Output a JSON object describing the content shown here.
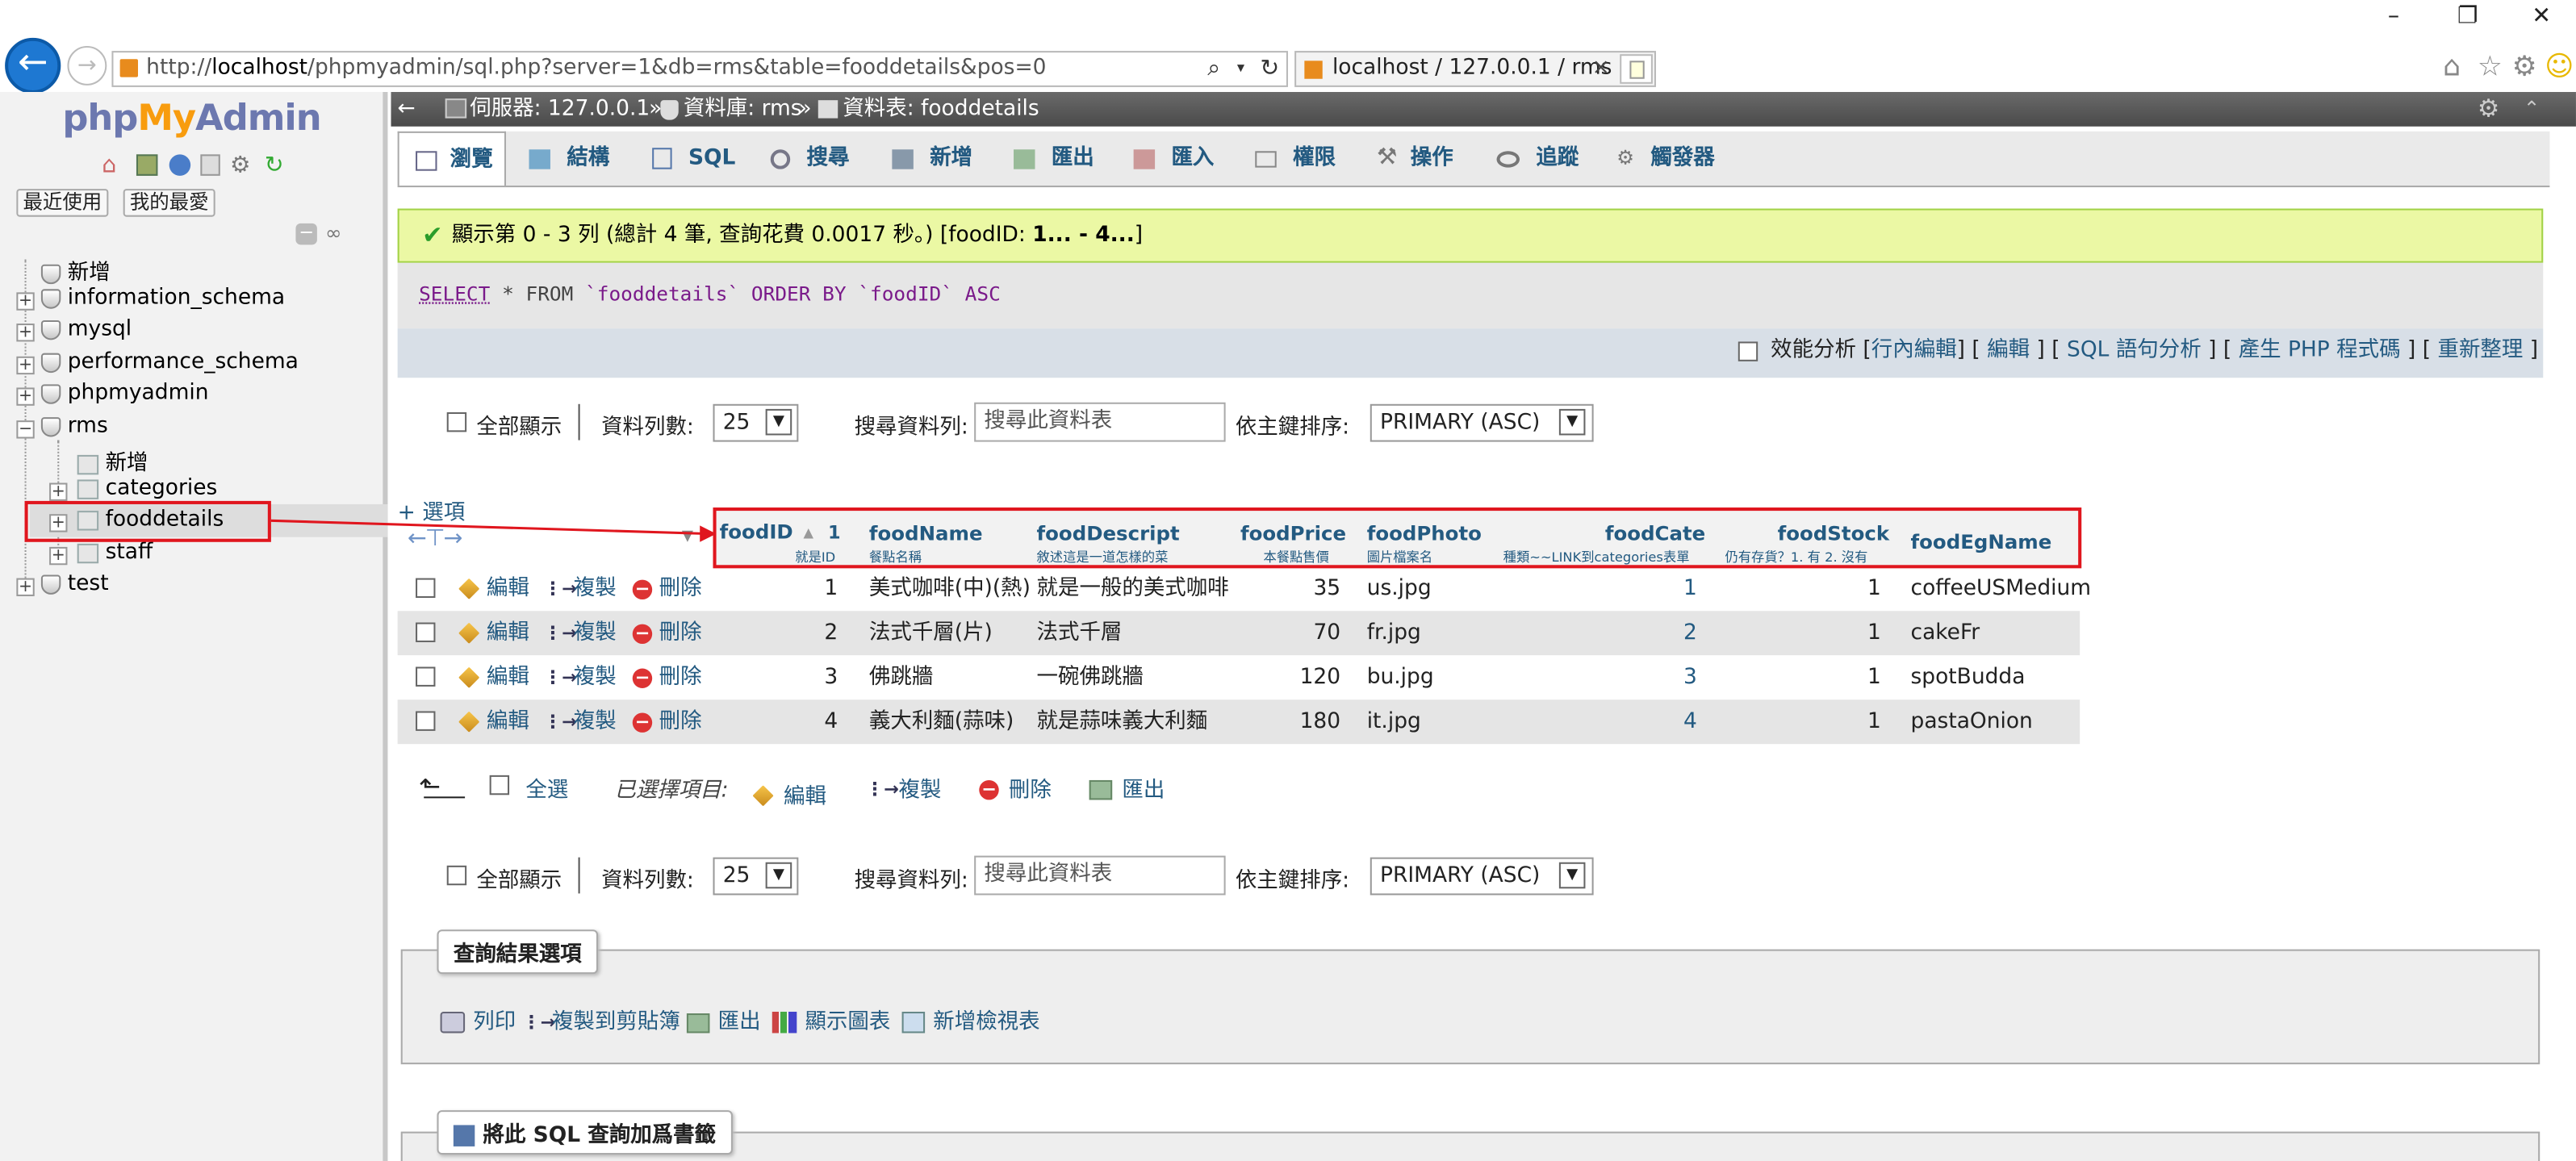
{
  "browser": {
    "url_prefix": "http://",
    "url_host": "localhost",
    "url_path": "/phpmyadmin/sql.php?server=1&db=rms&table=fooddetails&pos=0",
    "tab_title": "localhost / 127.0.0.1 / rms ...",
    "tab_close": "×",
    "win_min": "–",
    "win_restore": "❐",
    "win_close": "✕"
  },
  "sidebar": {
    "logo_php": "php",
    "logo_my": "My",
    "logo_admin": "Admin",
    "recent_label": "最近使用",
    "favorites_label": "我的最愛",
    "tree": [
      {
        "label": "新增"
      },
      {
        "label": "information_schema"
      },
      {
        "label": "mysql"
      },
      {
        "label": "performance_schema"
      },
      {
        "label": "phpmyadmin"
      },
      {
        "label": "rms"
      },
      {
        "label": "新增"
      },
      {
        "label": "categories"
      },
      {
        "label": "fooddetails"
      },
      {
        "label": "staff"
      },
      {
        "label": "test"
      }
    ]
  },
  "breadcrumb": {
    "server": "伺服器: 127.0.0.1",
    "sep1": "»",
    "database": "資料庫: rms",
    "sep2": "»",
    "table": "資料表: fooddetails"
  },
  "tabs": [
    "瀏覽",
    "結構",
    "SQL",
    "搜尋",
    "新增",
    "匯出",
    "匯入",
    "權限",
    "操作",
    "追蹤",
    "觸發器"
  ],
  "message": {
    "prefix": "顯示第 0 - 3 列 (總計 4 筆, 查詢花費 0.0017 秒。) [foodID: ",
    "bold": "1... - 4...",
    "suffix": "]"
  },
  "sql": {
    "keyword1": "SELECT",
    "rest1": " * FROM ",
    "table": "`fooddetails`",
    "keyword2": " ORDER BY ",
    "col": "`foodID`",
    "keyword3": " ASC"
  },
  "sql_options": {
    "profiling": "效能分析",
    "links": [
      "行內編輯",
      "編輯",
      "SQL 語句分析",
      "產生 PHP 程式碼",
      "重新整理"
    ]
  },
  "nav": {
    "show_all": "全部顯示",
    "rows_label": "資料列數:",
    "rows_value": "25",
    "search_label": "搜尋資料列:",
    "search_placeholder": "搜尋此資料表",
    "sort_label": "依主鍵排序:",
    "sort_value": "PRIMARY (ASC)"
  },
  "options_link": "+ 選項",
  "columns": [
    {
      "name": "foodID",
      "comment": "就是ID",
      "sort": "1"
    },
    {
      "name": "foodName",
      "comment": "餐點名稱"
    },
    {
      "name": "foodDescript",
      "comment": "敘述這是一道怎樣的菜"
    },
    {
      "name": "foodPrice",
      "comment": "本餐點售價"
    },
    {
      "name": "foodPhoto",
      "comment": "圖片檔案名"
    },
    {
      "name": "foodCate",
      "comment": "種類~~LINK到categories表單"
    },
    {
      "name": "foodStock",
      "comment": "仍有存貨？1. 有 2. 沒有"
    },
    {
      "name": "foodEgName",
      "comment": ""
    }
  ],
  "row_actions": {
    "edit": "編輯",
    "copy": "複製",
    "delete": "刪除"
  },
  "rows": [
    {
      "foodID": "1",
      "foodName": "美式咖啡(中)(熱)",
      "foodDescript": "就是一般的美式咖啡",
      "foodPrice": "35",
      "foodPhoto": "us.jpg",
      "foodCate": "1",
      "foodStock": "1",
      "foodEgName": "coffeeUSMedium"
    },
    {
      "foodID": "2",
      "foodName": "法式千層(片)",
      "foodDescript": "法式千層",
      "foodPrice": "70",
      "foodPhoto": "fr.jpg",
      "foodCate": "2",
      "foodStock": "1",
      "foodEgName": "cakeFr"
    },
    {
      "foodID": "3",
      "foodName": "佛跳牆",
      "foodDescript": "一碗佛跳牆",
      "foodPrice": "120",
      "foodPhoto": "bu.jpg",
      "foodCate": "3",
      "foodStock": "1",
      "foodEgName": "spotBudda"
    },
    {
      "foodID": "4",
      "foodName": "義大利麵(蒜味)",
      "foodDescript": "就是蒜味義大利麵",
      "foodPrice": "180",
      "foodPhoto": "it.jpg",
      "foodCate": "4",
      "foodStock": "1",
      "foodEgName": "pastaOnion"
    }
  ],
  "bulk": {
    "check_all": "全選",
    "selected": "已選擇項目:",
    "edit": "編輯",
    "copy": "複製",
    "delete": "刪除",
    "export": "匯出"
  },
  "query_results": {
    "legend": "查詢結果選項",
    "print": "列印",
    "copy_clipboard": "複製到剪貼簿",
    "export": "匯出",
    "chart": "顯示圖表",
    "create_view": "新增檢視表"
  },
  "bookmark": {
    "legend": "將此 SQL 查詢加爲書籤"
  },
  "colors": {
    "accent": "#235a81",
    "annotation": "#e0161e",
    "success_bg": "#ebf8a4"
  }
}
